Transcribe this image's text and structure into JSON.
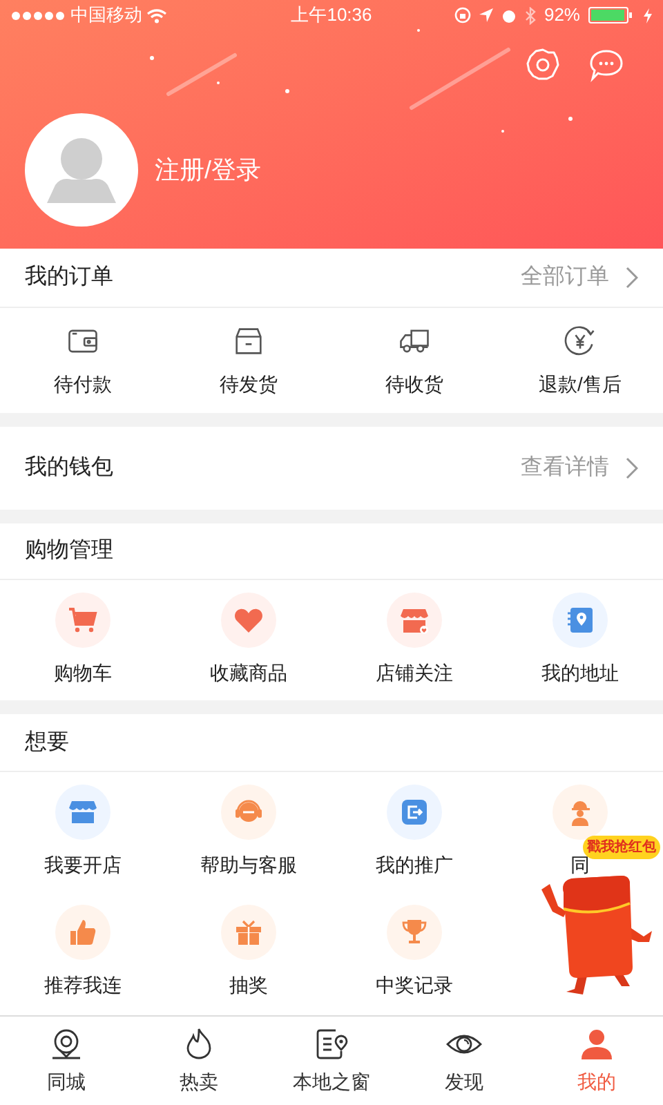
{
  "status_bar": {
    "carrier": "中国移动",
    "time": "上午10:36",
    "battery": "92%"
  },
  "profile": {
    "login_link": "注册/登录"
  },
  "orders": {
    "title": "我的订单",
    "link": "全部订单",
    "items": [
      {
        "label": "待付款"
      },
      {
        "label": "待发货"
      },
      {
        "label": "待收货"
      },
      {
        "label": "退款/售后"
      }
    ]
  },
  "wallet": {
    "title": "我的钱包",
    "link": "查看详情"
  },
  "shopping": {
    "title": "购物管理",
    "items": [
      {
        "label": "购物车"
      },
      {
        "label": "收藏商品"
      },
      {
        "label": "店铺关注"
      },
      {
        "label": "我的地址"
      }
    ]
  },
  "wants": {
    "title": "想要",
    "items": [
      {
        "label": "我要开店"
      },
      {
        "label": "帮助与客服"
      },
      {
        "label": "我的推广"
      },
      {
        "label": "同"
      },
      {
        "label": "推荐我连"
      },
      {
        "label": "抽奖"
      },
      {
        "label": "中奖记录"
      }
    ]
  },
  "floating_badge": {
    "label": "戳我抢红包"
  },
  "tab_bar": [
    {
      "label": "同城",
      "selected": false
    },
    {
      "label": "热卖",
      "selected": false
    },
    {
      "label": "本地之窗",
      "selected": false
    },
    {
      "label": "发现",
      "selected": false
    },
    {
      "label": "我的",
      "selected": true
    }
  ]
}
